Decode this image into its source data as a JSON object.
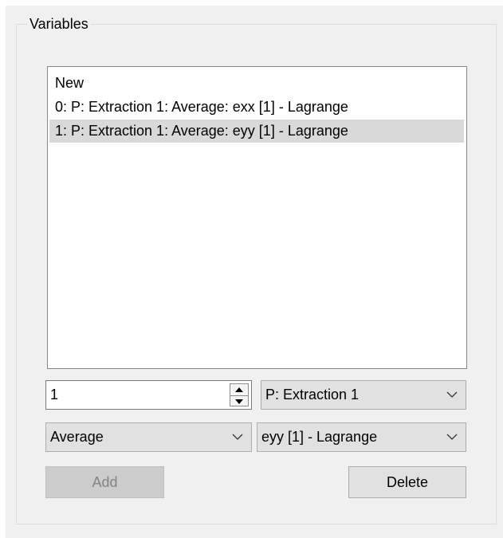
{
  "group": {
    "title": "Variables"
  },
  "variables_list": {
    "items": [
      {
        "label": "New",
        "selected": false
      },
      {
        "label": "0: P: Extraction 1: Average: exx [1] - Lagrange",
        "selected": false
      },
      {
        "label": "1: P: Extraction 1: Average: eyy [1] - Lagrange",
        "selected": true
      }
    ]
  },
  "index_spinbox": {
    "value": "1"
  },
  "extraction_combo": {
    "selected": "P: Extraction 1"
  },
  "statistic_combo": {
    "selected": "Average"
  },
  "quantity_combo": {
    "selected": "eyy [1] - Lagrange"
  },
  "buttons": {
    "add_label": "Add",
    "add_enabled": false,
    "delete_label": "Delete",
    "delete_enabled": true
  },
  "colors": {
    "panel_background": "#f0f0f0",
    "selection_highlight": "#d9d9d9",
    "disabled_button": "#cccccc",
    "disabled_text": "#838383"
  },
  "icons": {
    "spin_up": "triangle-up",
    "spin_down": "triangle-down",
    "dropdown": "chevron-down"
  }
}
